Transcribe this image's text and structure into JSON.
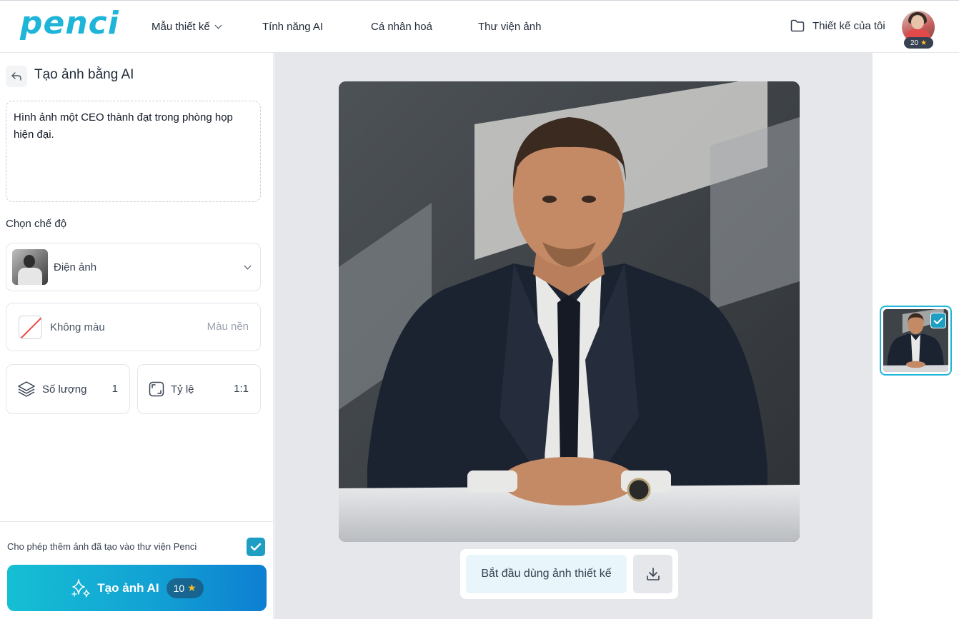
{
  "brand": {
    "logo_text": "penci",
    "accent": "#1fb5d8"
  },
  "nav": {
    "items": [
      {
        "label": "Mẫu thiết kế",
        "has_dropdown": true
      },
      {
        "label": "Tính năng AI"
      },
      {
        "label": "Cá nhân hoá"
      },
      {
        "label": "Thư viện ảnh"
      }
    ],
    "my_designs": "Thiết kế của tôi",
    "stars": "20"
  },
  "panel": {
    "title": "Tạo ảnh bằng AI",
    "prompt": "Hình ảnh một CEO thành đạt trong phòng họp hiện đại.",
    "mode_section_label": "Chọn chế độ",
    "mode_value": "Điện ảnh",
    "color_label": "Không màu",
    "color_right_label": "Màu nền",
    "quantity_label": "Số lượng",
    "quantity_value": "1",
    "ratio_label": "Tỷ lệ",
    "ratio_value": "1:1",
    "allow_library_label": "Cho phép thêm ảnh đã tạo vào thư viện Penci",
    "allow_library_checked": true,
    "generate_label": "Tạo ảnh AI",
    "generate_cost": "10"
  },
  "canvas": {
    "use_image_label": "Bắt đầu dùng ảnh thiết kế"
  },
  "icons": [
    "back-arrow-icon",
    "chevron-down-icon",
    "folder-icon",
    "star-icon",
    "layers-icon",
    "aspect-ratio-icon",
    "check-icon",
    "sparkle-icon",
    "download-icon"
  ]
}
